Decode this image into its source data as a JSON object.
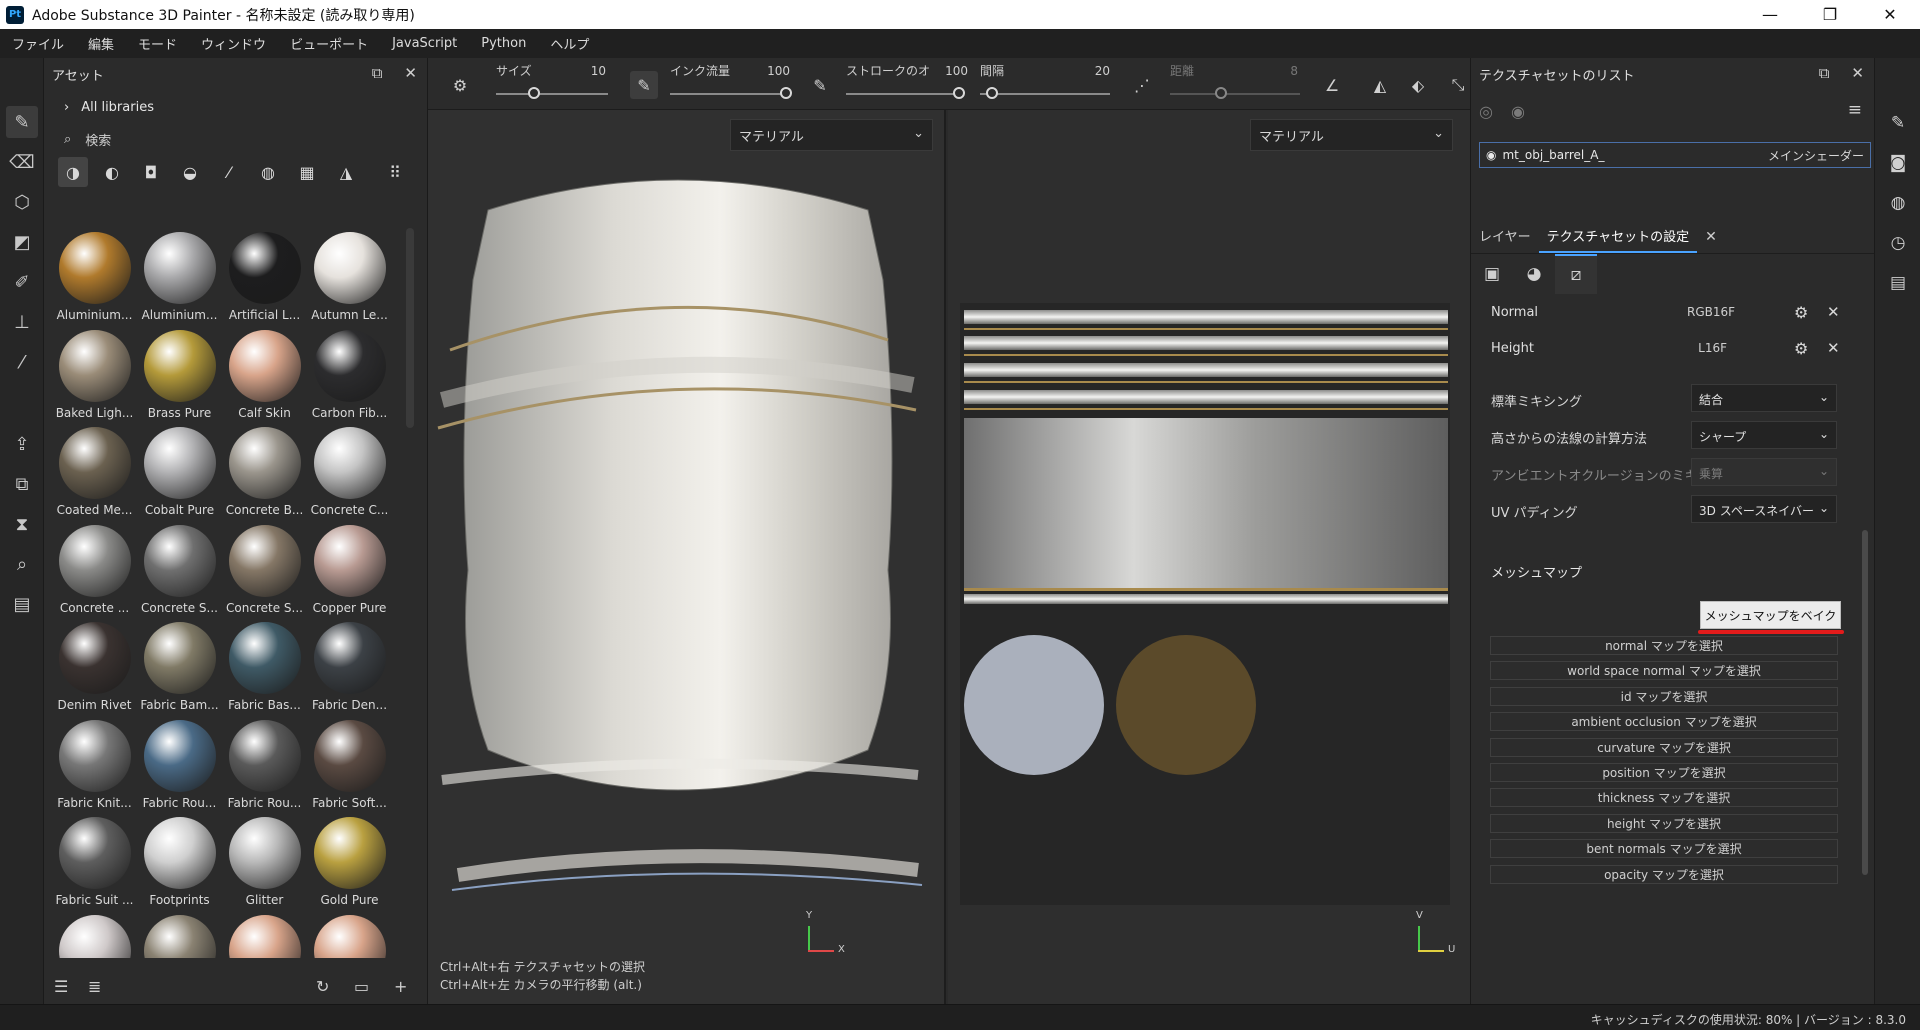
{
  "window": {
    "app_icon": "Pt",
    "title": "Adobe Substance 3D Painter - 名称未設定 (読み取り専用)",
    "minimize": "—",
    "maximize": "❐",
    "close": "✕"
  },
  "menu": [
    "ファイル",
    "編集",
    "モード",
    "ウィンドウ",
    "ビューポート",
    "JavaScript",
    "Python",
    "ヘルプ"
  ],
  "assets": {
    "title": "アセット",
    "library": "All libraries",
    "search_placeholder": "検索",
    "materials": [
      {
        "name": "Aluminium...",
        "color": "#b07a2c"
      },
      {
        "name": "Aluminium...",
        "color": "#a9a9ab"
      },
      {
        "name": "Artificial L...",
        "color": "#1d1d1e"
      },
      {
        "name": "Autumn Le...",
        "color": "#e6e2dd"
      },
      {
        "name": "Baked Ligh...",
        "color": "#9a8c78"
      },
      {
        "name": "Brass Pure",
        "color": "#b49a3a"
      },
      {
        "name": "Calf Skin",
        "color": "#d8a48a"
      },
      {
        "name": "Carbon Fib...",
        "color": "#2c2c2e"
      },
      {
        "name": "Coated Me...",
        "color": "#6b6150"
      },
      {
        "name": "Cobalt Pure",
        "color": "#b2b2b4"
      },
      {
        "name": "Concrete B...",
        "color": "#9a958c"
      },
      {
        "name": "Concrete C...",
        "color": "#c4c4c4"
      },
      {
        "name": "Concrete ...",
        "color": "#8a8a88"
      },
      {
        "name": "Concrete S...",
        "color": "#6f6f6f"
      },
      {
        "name": "Concrete S...",
        "color": "#857766"
      },
      {
        "name": "Copper Pure",
        "color": "#b89a92"
      },
      {
        "name": "Denim Rivet",
        "color": "#3a3230"
      },
      {
        "name": "Fabric Bam...",
        "color": "#807a66"
      },
      {
        "name": "Fabric Bas...",
        "color": "#3f5a66"
      },
      {
        "name": "Fabric Den...",
        "color": "#3c4146"
      },
      {
        "name": "Fabric Knit...",
        "color": "#777777"
      },
      {
        "name": "Fabric Rou...",
        "color": "#4a6a86"
      },
      {
        "name": "Fabric Rou...",
        "color": "#5a5a5a"
      },
      {
        "name": "Fabric Soft...",
        "color": "#5a4a42"
      },
      {
        "name": "Fabric Suit ...",
        "color": "#5e5e5e"
      },
      {
        "name": "Footprints",
        "color": "#cfcfcf"
      },
      {
        "name": "Glitter",
        "color": "#b8b8b8"
      },
      {
        "name": "Gold Pure",
        "color": "#b9a040"
      },
      {
        "name": "",
        "color": "#cfc9c9"
      },
      {
        "name": "",
        "color": "#8a8272"
      },
      {
        "name": "",
        "color": "#d8a48a"
      },
      {
        "name": "",
        "color": "#d8a48a"
      }
    ]
  },
  "toolbar": {
    "size_label": "サイズ",
    "size_value": "10",
    "flow_label": "インク流量",
    "flow_value": "100",
    "stroke_label": "ストロークのオ",
    "stroke_value": "100",
    "spacing_label": "間隔",
    "spacing_value": "20",
    "distance_label": "距離",
    "distance_value": "8"
  },
  "viewport": {
    "left_mode": "マテリアル",
    "right_mode": "マテリアル",
    "hint1": "Ctrl+Alt+右  テクスチャセットの選択",
    "hint2": "Ctrl+Alt+左  カメラの平行移動 (alt.)",
    "axis3d_y": "Y",
    "axis3d_x": "X",
    "axis2d_v": "V",
    "axis2d_u": "U"
  },
  "texture_set_list": {
    "title": "テクスチャセットのリスト",
    "item_name": "mt_obj_barrel_A_",
    "item_shader": "メインシェーダー"
  },
  "tabs": {
    "layers": "レイヤー",
    "settings": "テクスチャセットの設定"
  },
  "channels": [
    {
      "name": "Normal",
      "format": "RGB16F"
    },
    {
      "name": "Height",
      "format": "L16F"
    }
  ],
  "settings": {
    "normal_mixing_label": "標準ミキシング",
    "normal_mixing_value": "結合",
    "height_normal_label": "高さからの法線の計算方法",
    "height_normal_value": "シャープ",
    "ao_mixing_label": "アンビエントオクルージョンのミキシング",
    "ao_mixing_value": "乗算",
    "uv_padding_label": "UV パディング",
    "uv_padding_value": "3D スペースネイバー"
  },
  "mesh_maps": {
    "title": "メッシュマップ",
    "bake_button": "メッシュマップをベイク",
    "maps": [
      "normal マップを選択",
      "world space normal マップを選択",
      "id マップを選択",
      "ambient occlusion マップを選択",
      "curvature マップを選択",
      "position マップを選択",
      "thickness マップを選択",
      "height マップを選択",
      "bent normals マップを選択",
      "opacity マップを選択"
    ]
  },
  "status": {
    "text": "キャッシュディスクの使用状況:   80% | バージョン : 8.3.0"
  }
}
